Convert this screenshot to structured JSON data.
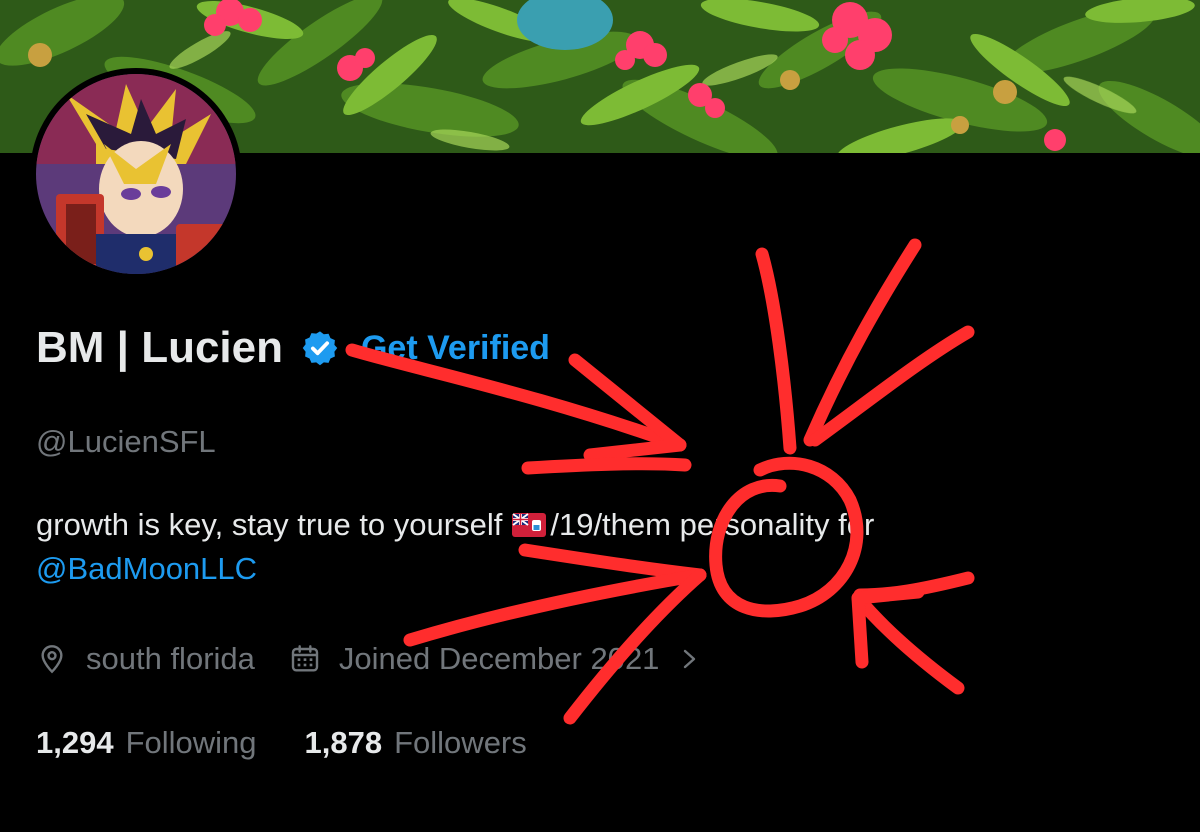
{
  "profile": {
    "display_name": "BM | Lucien",
    "get_verified_label": "Get Verified",
    "handle": "@LucienSFL",
    "bio_text": "growth is key, stay true to yourself",
    "bio_after_flag": "/19/them personality for",
    "bio_mention": "@BadMoonLLC",
    "location": "south florida",
    "joined": "Joined December 2021",
    "following_count": "1,294",
    "following_label": "Following",
    "followers_count": "1,878",
    "followers_label": "Followers"
  },
  "icons": {
    "verified": "verified-badge-icon",
    "location": "location-pin-icon",
    "calendar": "calendar-icon",
    "chevron": "chevron-right-icon",
    "flag": "bermuda-flag-icon"
  },
  "colors": {
    "background": "#000000",
    "text_primary": "#e7e9ea",
    "text_secondary": "#71767b",
    "accent": "#1d9bf0",
    "annotation": "#ff2d2d"
  }
}
